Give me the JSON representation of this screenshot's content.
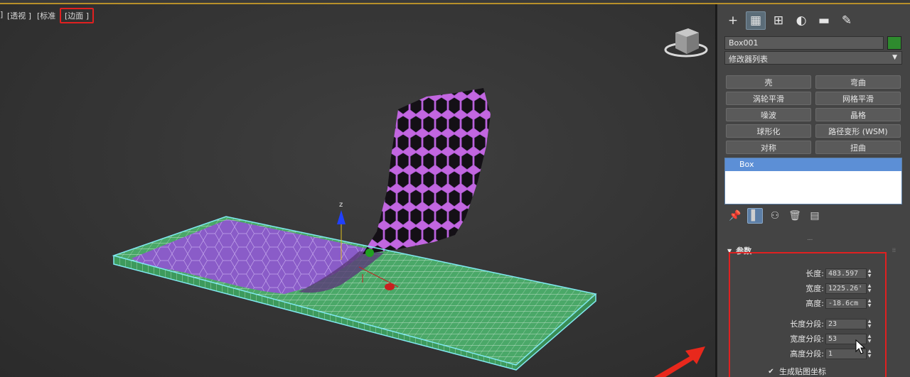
{
  "viewport": {
    "bracket": "]",
    "label_persp": "[透视 ]",
    "label_standard": "[标准",
    "label_edged": "[边面 ]",
    "axis_z": "z"
  },
  "panel": {
    "tabs": [
      {
        "icon": "create-icon",
        "glyph": "+"
      },
      {
        "icon": "modify-icon",
        "glyph": "▦"
      },
      {
        "icon": "hierarchy-icon",
        "glyph": "⊞"
      },
      {
        "icon": "motion-icon",
        "glyph": "◐"
      },
      {
        "icon": "display-icon",
        "glyph": "▬"
      },
      {
        "icon": "utilities-icon",
        "glyph": "✎"
      }
    ],
    "object_name": "Box001",
    "object_color": "#2e8b2e",
    "modifier_list": "修改器列表",
    "modifiers": [
      "壳",
      "弯曲",
      "涡轮平滑",
      "网格平滑",
      "噪波",
      "晶格",
      "球形化",
      "路径变形 (WSM)",
      "对称",
      "扭曲"
    ],
    "stack": [
      "Box"
    ],
    "rollout_title": "参数",
    "params": [
      {
        "label": "长度:",
        "value": "483.597"
      },
      {
        "label": "宽度:",
        "value": "1225.26'"
      },
      {
        "label": "高度:",
        "value": "-18.6cm"
      },
      {
        "label": "长度分段:",
        "value": "23"
      },
      {
        "label": "宽度分段:",
        "value": "53"
      },
      {
        "label": "高度分段:",
        "value": "1"
      }
    ],
    "checkbox_label": "生成贴图坐标",
    "checkbox_checked": true
  },
  "colors": {
    "highlight_red": "#e02020",
    "mesh_purple": "#8a5cc8",
    "mesh_green": "#4aa868",
    "selection_cyan": "#7fe8f0",
    "stack_selected": "#5c8fd6"
  }
}
